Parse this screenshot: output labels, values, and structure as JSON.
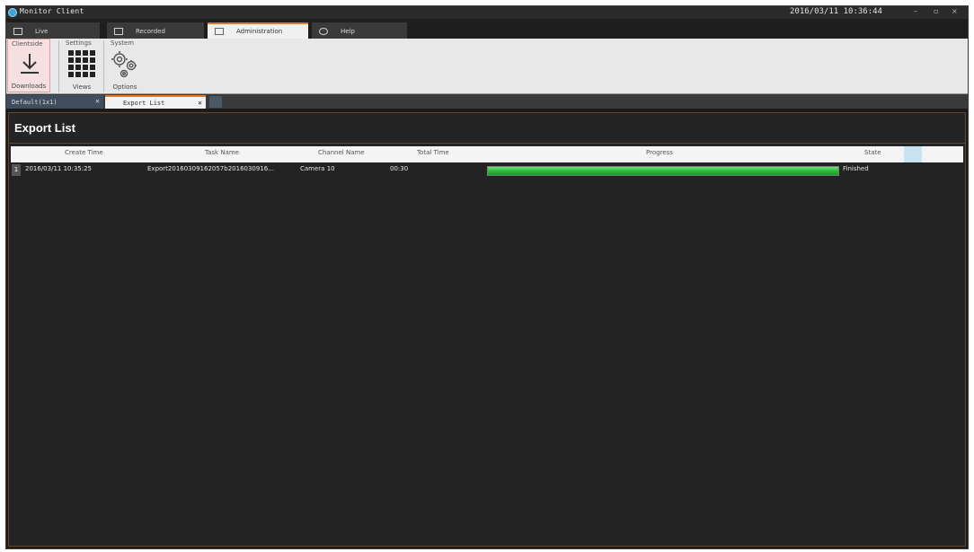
{
  "window": {
    "title": "Monitor Client",
    "datetime": "2016/03/11 10:36:44",
    "controls": [
      "minimize-icon",
      "maximize-icon",
      "close-icon"
    ]
  },
  "menu": {
    "tabs": [
      {
        "label": "Live",
        "icon": "monitor-icon"
      },
      {
        "label": "Recorded",
        "icon": "playback-icon"
      },
      {
        "label": "Administration",
        "icon": "admin-icon",
        "active": true
      },
      {
        "label": "Help",
        "icon": "help-icon"
      }
    ]
  },
  "ribbon": {
    "groups": [
      {
        "label": "Clientside",
        "buttons": [
          {
            "label": "Downloads",
            "icon": "download-icon",
            "active": true
          }
        ]
      },
      {
        "label": "Settings",
        "buttons": [
          {
            "label": "Views",
            "icon": "grid-icon"
          }
        ]
      },
      {
        "label": "System",
        "buttons": [
          {
            "label": "Options",
            "icon": "gears-icon"
          }
        ]
      }
    ]
  },
  "doc_tabs": [
    {
      "label": "Default(1x1)",
      "active": false
    },
    {
      "label": "Export List",
      "active": true
    }
  ],
  "export_list": {
    "title": "Export List",
    "columns": [
      "Create Time",
      "Task Name",
      "Channel Name",
      "Total Time",
      "Progress",
      "State"
    ],
    "rows": [
      {
        "index": "1",
        "create_time": "2016/03/11 10:35:25",
        "task_name": "Export20160309162057b2016030916...",
        "channel_name": "Camera 10",
        "total_time": "00:30",
        "progress": 1.0,
        "state": "Finished"
      }
    ]
  },
  "colors": {
    "accent": "#e07a2a",
    "progress": "#23b836",
    "panel_bg": "#232323"
  }
}
